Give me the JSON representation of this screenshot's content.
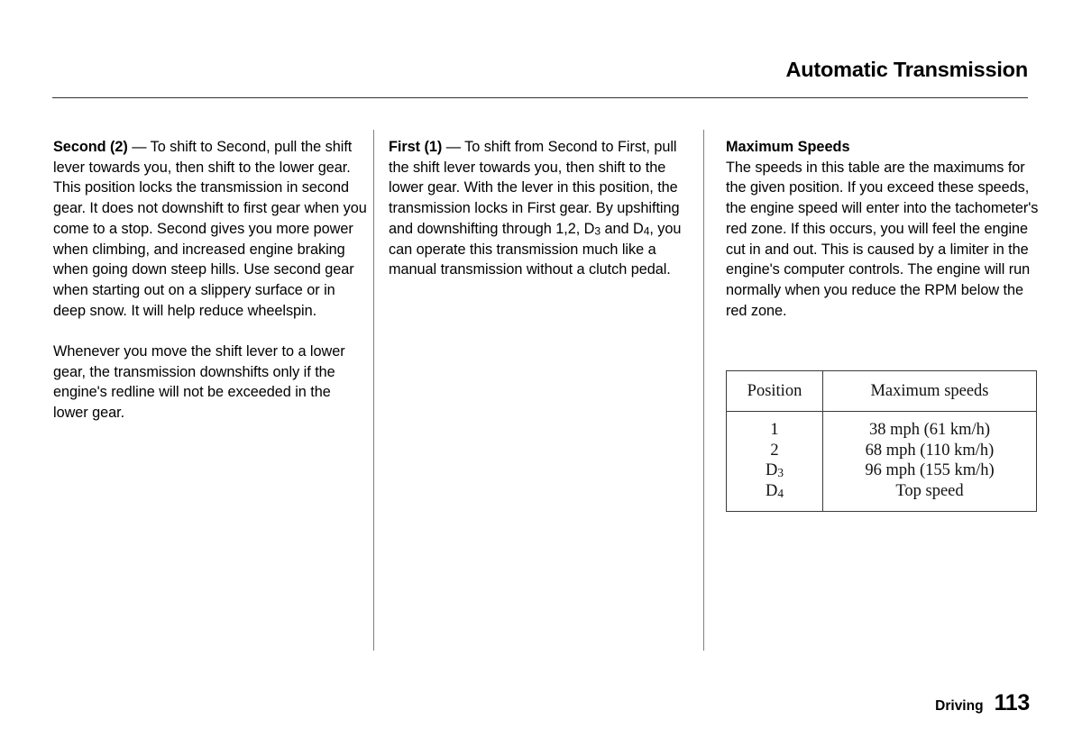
{
  "header": {
    "title": "Automatic Transmission"
  },
  "columns": {
    "left": {
      "paragraph_1_lead": "Second (2)",
      "paragraph_1_body": " — To shift to Second, pull the shift lever towards you, then shift to the lower gear. This position locks the transmission in second gear. It does not downshift to first gear when you come to a stop. Second gives you more power when climbing, and increased engine braking when going down steep hills. Use second gear when starting out on a slippery surface or in deep snow. It will help reduce wheelspin.",
      "paragraph_2": "Whenever you move the shift lever to a lower gear, the transmission downshifts only if the engine's redline will not be exceeded in the lower gear."
    },
    "middle": {
      "paragraph_1_lead": "First (1)",
      "paragraph_1_body_part1": " — To shift from Second to First, pull the shift lever towards you, then shift to the lower gear. With the lever in this position, the transmission locks in First gear. By upshifting and downshifting through 1,2, D",
      "paragraph_1_sub1": "3",
      "paragraph_1_body_part2": " and D",
      "paragraph_1_sub2": "4",
      "paragraph_1_body_part3": ", you can operate this transmission much like a manual transmission without a clutch pedal."
    },
    "right": {
      "heading": "Maximum Speeds",
      "paragraph_1": "The speeds in this table are the maximums for the given position. If you exceed these speeds, the engine speed will enter into the tachometer's red zone. If this occurs, you will feel the engine cut in and out. This is caused by a limiter in the engine's computer controls. The engine will run normally when you reduce the RPM below the red zone."
    }
  },
  "speeds_table": {
    "headers": [
      "Position",
      "Maximum speeds"
    ],
    "rows": [
      {
        "position": "1",
        "position_sub": "",
        "speed": "38 mph (61 km/h)"
      },
      {
        "position": "2",
        "position_sub": "",
        "speed": "68 mph (110 km/h)"
      },
      {
        "position": "D",
        "position_sub": "3",
        "speed": "96 mph (155 km/h)"
      },
      {
        "position": "D",
        "position_sub": "4",
        "speed": "Top speed"
      }
    ]
  },
  "footer": {
    "section": "Driving",
    "page_number": "113"
  }
}
